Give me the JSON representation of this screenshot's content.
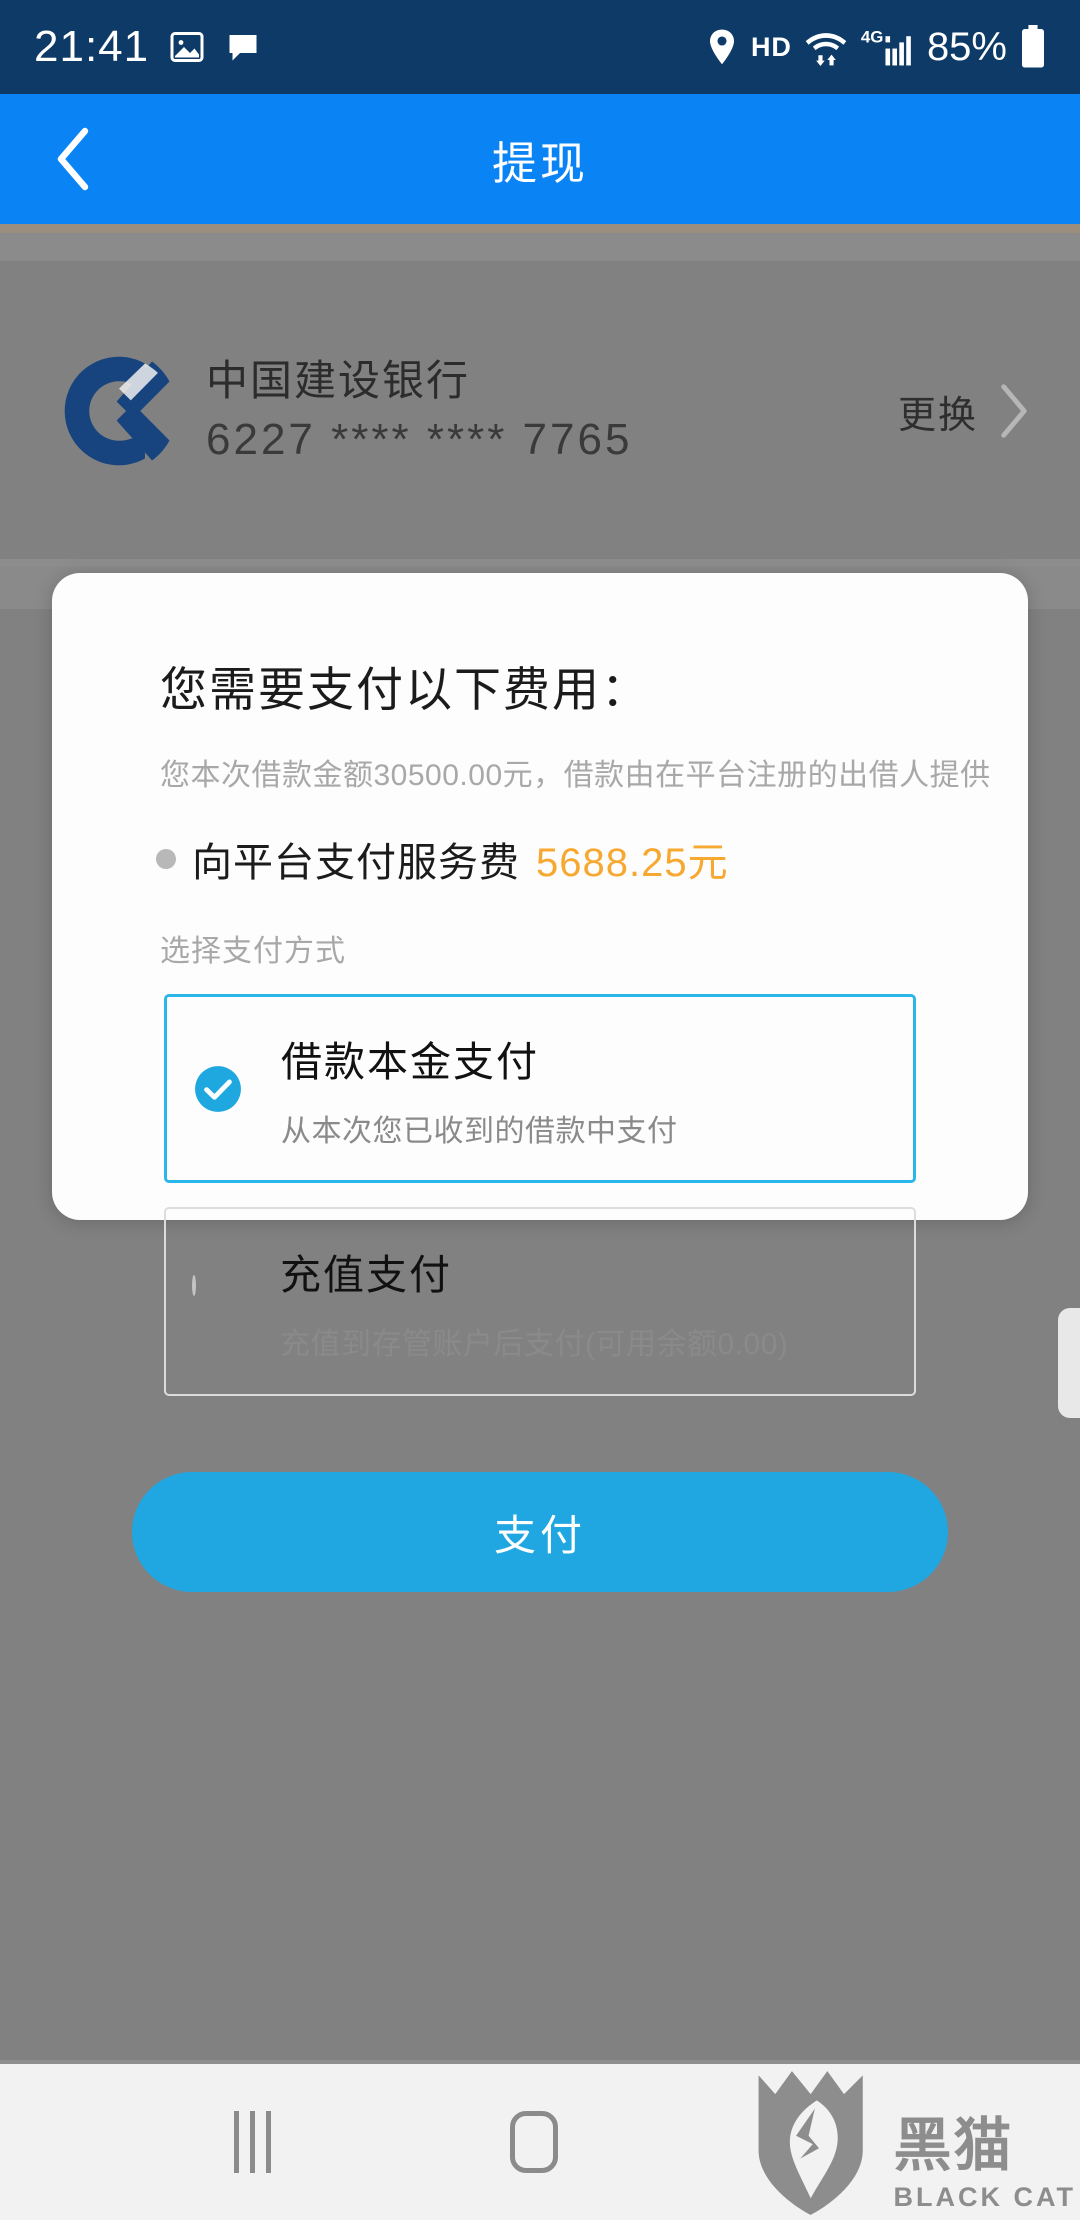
{
  "status_bar": {
    "time": "21:41",
    "hd_label": "HD",
    "network_label": "4G",
    "battery_percent": "85%",
    "icons": [
      "gallery-icon",
      "message-icon",
      "location-icon",
      "wifi-icon",
      "signal-icon",
      "battery-icon"
    ],
    "background_color": "#0d3a66"
  },
  "header": {
    "title": "提现",
    "back_icon": "chevron-left-icon",
    "background_color": "#0a84f5"
  },
  "background_page": {
    "bank": {
      "logo_name": "ccb-logo",
      "name": "中国建设银行",
      "card_number": "6227 **** **** 7765",
      "change_label": "更换",
      "chevron_icon": "chevron-right-icon"
    },
    "overlay_color": "#818181"
  },
  "dialog": {
    "title": "您需要支付以下费用：",
    "subtitle": "您本次借款金额30500.00元，借款由在平台注册的出借人提供",
    "fee": {
      "label": "向平台支付服务费",
      "amount": "5688.25元",
      "amount_color": "#f7a830"
    },
    "payment_methods_label": "选择支付方式",
    "payment_methods": [
      {
        "title": "借款本金支付",
        "desc": "从本次您已收到的借款中支付",
        "selected": true,
        "radio_icon": "check-circle-icon"
      },
      {
        "title": "充值支付",
        "desc": "充值到存管账户后支付(可用余额0.00)",
        "selected": false,
        "radio_icon": "radio-empty-icon"
      }
    ],
    "pay_button_label": "支付",
    "pay_button_color": "#20a7e2",
    "accent_color": "#2ab6e8"
  },
  "nav_bar": {
    "recents_icon": "recents-icon",
    "home_icon": "home-icon",
    "watermark_cn": "黑猫",
    "watermark_en": "BLACK CAT"
  }
}
